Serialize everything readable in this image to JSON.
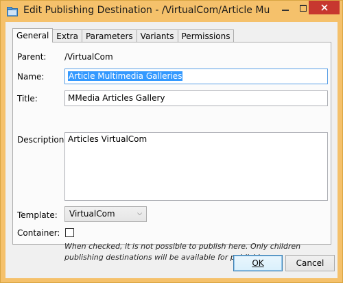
{
  "window": {
    "title": "Edit Publishing Destination - /VirtualCom/Article Mul..."
  },
  "tabs": [
    "General",
    "Extra",
    "Parameters",
    "Variants",
    "Permissions"
  ],
  "active_tab": "General",
  "form": {
    "parent": {
      "label": "Parent:",
      "value": "/VirtualCom"
    },
    "name": {
      "label": "Name:",
      "value": "Article Multimedia Galleries"
    },
    "title": {
      "label": "Title:",
      "value": "MMedia Articles Gallery"
    },
    "description": {
      "label": "Description:",
      "value": "Articles VirtualCom"
    },
    "template": {
      "label": "Template:",
      "value": "VirtualCom"
    },
    "container": {
      "label": "Container:",
      "checked": false,
      "note": "When checked, it is not possible to publish here. Only children publishing destinations will be available for publishing"
    }
  },
  "buttons": {
    "ok": "OK",
    "cancel": "Cancel"
  },
  "colors": {
    "title_bar": "#f5c16b",
    "close_button": "#c7372f",
    "selection": "#3399ff"
  }
}
